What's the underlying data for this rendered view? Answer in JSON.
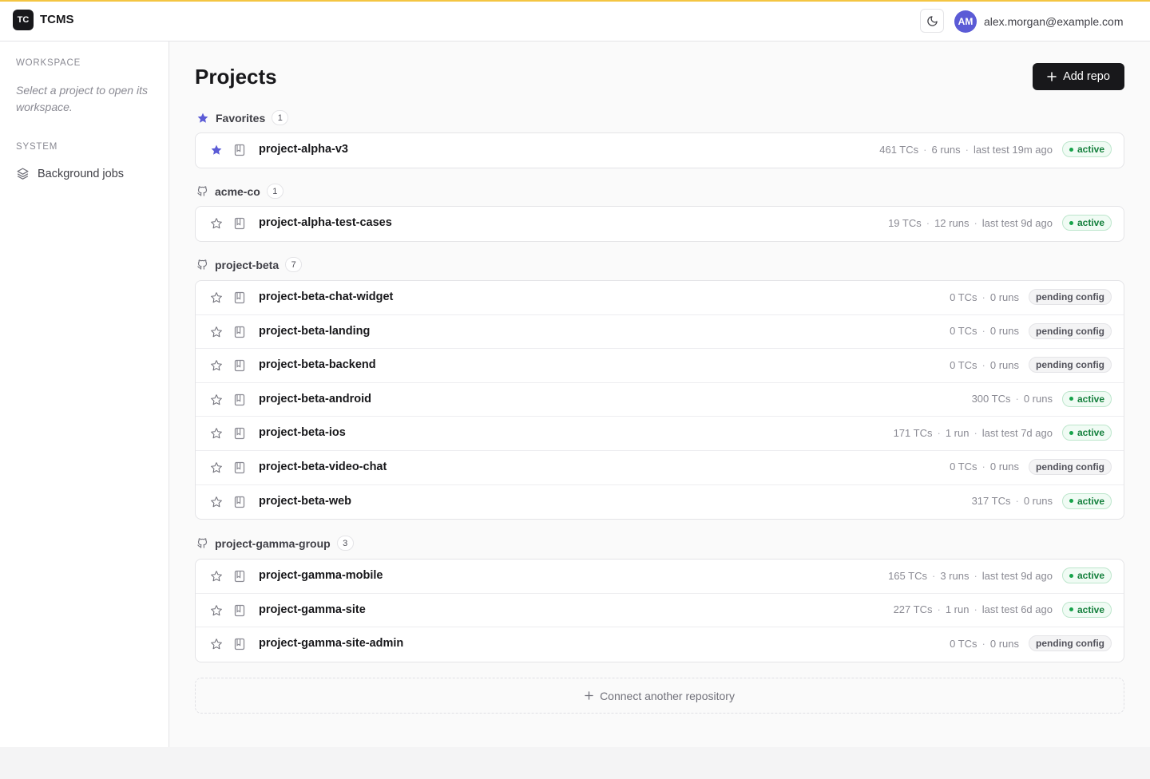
{
  "app": {
    "logo_text": "TC",
    "title": "TCMS"
  },
  "header": {
    "avatar_initials": "AM",
    "user_email": "alex.morgan@example.com"
  },
  "sidebar": {
    "workspace_heading": "WORKSPACE",
    "workspace_hint": "Select a project to open its workspace.",
    "system_heading": "SYSTEM",
    "items": [
      {
        "label": "Background jobs",
        "icon": "layers-icon"
      }
    ]
  },
  "main": {
    "title": "Projects",
    "add_button_label": "Add repo",
    "connect_label": "Connect another repository"
  },
  "colors": {
    "accent": "#5b5bd6",
    "active_green": "#15803d",
    "top_border": "#f4c542"
  },
  "groups": [
    {
      "name": "Favorites",
      "count": "1",
      "icon": "star-icon",
      "projects": [
        {
          "name": "project-alpha-v3",
          "tcs": "461 TCs",
          "runs": "6 runs",
          "last_test": "last test 19m ago",
          "status": "active",
          "starred": true
        }
      ]
    },
    {
      "name": "acme-co",
      "count": "1",
      "icon": "github-icon",
      "projects": [
        {
          "name": "project-alpha-test-cases",
          "tcs": "19 TCs",
          "runs": "12 runs",
          "last_test": "last test 9d ago",
          "status": "active",
          "starred": false
        }
      ]
    },
    {
      "name": "project-beta",
      "count": "7",
      "icon": "github-icon",
      "projects": [
        {
          "name": "project-beta-chat-widget",
          "tcs": "0 TCs",
          "runs": "0 runs",
          "last_test": "",
          "status": "pending config",
          "starred": false
        },
        {
          "name": "project-beta-landing",
          "tcs": "0 TCs",
          "runs": "0 runs",
          "last_test": "",
          "status": "pending config",
          "starred": false
        },
        {
          "name": "project-beta-backend",
          "tcs": "0 TCs",
          "runs": "0 runs",
          "last_test": "",
          "status": "pending config",
          "starred": false
        },
        {
          "name": "project-beta-android",
          "tcs": "300 TCs",
          "runs": "0 runs",
          "last_test": "",
          "status": "active",
          "starred": false
        },
        {
          "name": "project-beta-ios",
          "tcs": "171 TCs",
          "runs": "1 run",
          "last_test": "last test 7d ago",
          "status": "active",
          "starred": false
        },
        {
          "name": "project-beta-video-chat",
          "tcs": "0 TCs",
          "runs": "0 runs",
          "last_test": "",
          "status": "pending config",
          "starred": false
        },
        {
          "name": "project-beta-web",
          "tcs": "317 TCs",
          "runs": "0 runs",
          "last_test": "",
          "status": "active",
          "starred": false
        }
      ]
    },
    {
      "name": "project-gamma-group",
      "count": "3",
      "icon": "github-icon",
      "projects": [
        {
          "name": "project-gamma-mobile",
          "tcs": "165 TCs",
          "runs": "3 runs",
          "last_test": "last test 9d ago",
          "status": "active",
          "starred": false
        },
        {
          "name": "project-gamma-site",
          "tcs": "227 TCs",
          "runs": "1 run",
          "last_test": "last test 6d ago",
          "status": "active",
          "starred": false
        },
        {
          "name": "project-gamma-site-admin",
          "tcs": "0 TCs",
          "runs": "0 runs",
          "last_test": "",
          "status": "pending config",
          "starred": false
        }
      ]
    }
  ]
}
